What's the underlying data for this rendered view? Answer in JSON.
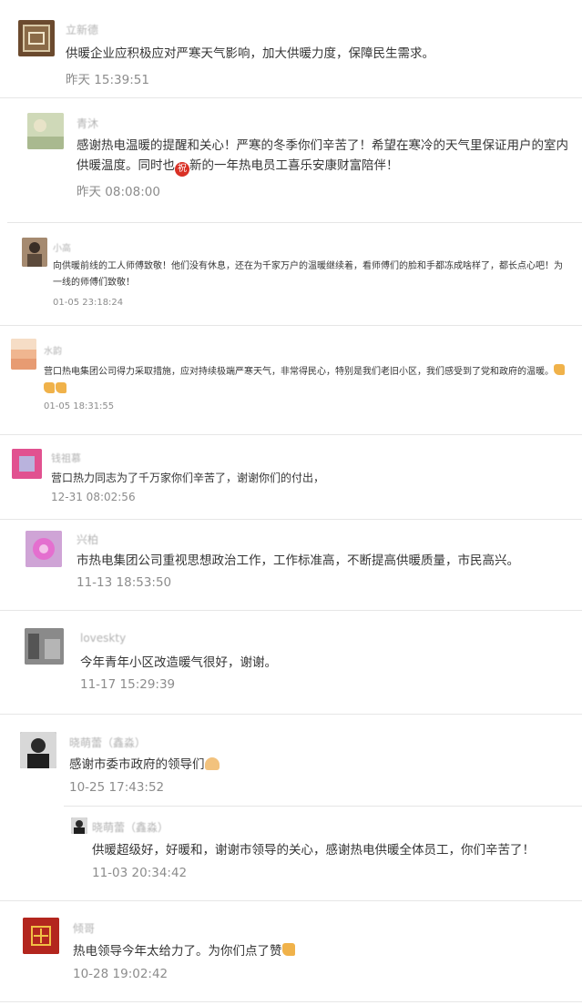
{
  "comments": [
    {
      "name": "立新德",
      "text": "供暖企业应积极应对严寒天气影响，加大供暖力度，保障民生需求。",
      "time": "昨天 15:39:51",
      "avatar_icon": "seal-logo",
      "avatar_bg": "#6b4a2e"
    },
    {
      "name": "青沐",
      "text_pre": "感谢热电温暖的提醒和关心！严寒的冬季你们辛苦了！希望在寒冷的天气里保证用户的室内供暖温度。同时也",
      "emoji": "祝",
      "text_post": "新的一年热电员工喜乐安康财富陪伴！",
      "time": "昨天 08:08:00",
      "avatar_icon": "landscape-photo",
      "avatar_bg": "#c8d2b0"
    },
    {
      "name": "小高",
      "text": "向供暖前线的工人师傅致敬！他们没有休息，还在为千家万户的温暖继续着，看师傅们的脸和手都冻成啥样了，都长点心吧！为一线的师傅们致敬！",
      "time": "01-05 23:18:24",
      "avatar_icon": "person-photo",
      "avatar_bg": "#8a6f5a"
    },
    {
      "name": "水韵",
      "text": "营口热电集团公司得力采取措施，应对持续极端严寒天气，非常得民心，特别是我们老旧小区，我们感受到了党和政府的温暖。",
      "time": "01-05 18:31:55",
      "avatar_icon": "gradient-photo",
      "avatar_bg": "#f3c9a8"
    },
    {
      "name": "钱祖慕",
      "text": "营口热力同志为了千万家你们辛苦了，谢谢你们的付出，",
      "time": "12-31 08:02:56",
      "avatar_icon": "pink-square",
      "avatar_bg": "#e0508a"
    },
    {
      "name": "兴柏",
      "text": "市热电集团公司重视思想政治工作，工作标准高，不断提高供暖质量，市民高兴。",
      "time": "11-13 18:53:50",
      "avatar_icon": "flower-photo",
      "avatar_bg": "#d77ad6"
    },
    {
      "name": "loveskty",
      "text": "今年青年小区改造暖气很好，谢谢。",
      "time": "11-17 15:29:39",
      "avatar_icon": "street-photo",
      "avatar_bg": "#7a7a7a"
    },
    {
      "name": "晓萌蕾（鑫淼）",
      "text": "感谢市委市政府的领导们",
      "time": "10-25 17:43:52",
      "avatar_icon": "portrait-photo",
      "avatar_bg": "#3b3b3b",
      "reply": {
        "name": "晓萌蕾（鑫淼）",
        "text": "供暖超级好，好暖和，谢谢市领导的关心，感谢热电供暖全体员工，你们辛苦了！",
        "time": "11-03 20:34:42"
      }
    },
    {
      "name": "倾哥",
      "text": "热电领导今年太给力了。为你们点了赞",
      "time": "10-28 19:02:42",
      "avatar_icon": "red-seal",
      "avatar_bg": "#b3261e"
    }
  ]
}
